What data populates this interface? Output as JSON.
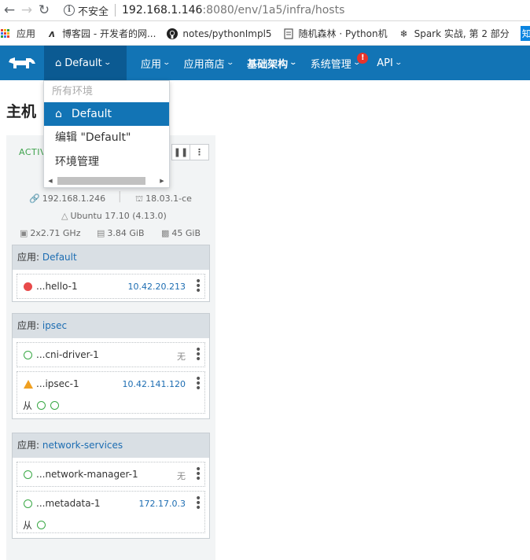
{
  "browser": {
    "insecure_label": "不安全",
    "url_host": "192.168.1.146",
    "url_path": ":8080/env/1a5/infra/hosts"
  },
  "bookmarks": [
    {
      "label": "应用",
      "icon": "apps-grid-icon"
    },
    {
      "label": "博客园 - 开发者的网...",
      "icon": "cnblogs-icon"
    },
    {
      "label": "notes/pythonImpl5",
      "icon": "github-icon"
    },
    {
      "label": "随机森林 · Python机",
      "icon": "page-icon"
    },
    {
      "label": "Spark 实战, 第 2 部分",
      "icon": "spark-icon"
    },
    {
      "label": "知",
      "icon": "zhihu-icon"
    }
  ],
  "header": {
    "env_label": "Default",
    "nav": [
      {
        "label": "应用",
        "bold": false
      },
      {
        "label": "应用商店",
        "bold": false
      },
      {
        "label": "基础架构",
        "bold": true
      },
      {
        "label": "系统管理",
        "bold": false,
        "badge": "!"
      },
      {
        "label": "API",
        "bold": false
      }
    ]
  },
  "dropdown": {
    "header": "所有环境",
    "selected": "Default",
    "items": [
      "编辑 \"Default\"",
      "环境管理"
    ]
  },
  "page": {
    "title": "主机"
  },
  "host": {
    "state": "ACTIVE",
    "ip": "192.168.1.246",
    "docker_version": "18.03.1-ce",
    "os": "Ubuntu 17.10 (4.13.0)",
    "cpu": "2x2.71 GHz",
    "memory": "3.84 GiB",
    "disk": "45 GiB"
  },
  "stacks": [
    {
      "prefix": "应用: ",
      "name": "Default",
      "containers": [
        {
          "name": "...hello-1",
          "ip": "10.42.20.213",
          "status": "stopped"
        }
      ]
    },
    {
      "prefix": "应用: ",
      "name": "ipsec",
      "containers": [
        {
          "name": "...cni-driver-1",
          "ip": "无",
          "status": "running"
        },
        {
          "name": "...ipsec-1",
          "ip": "10.42.141.120",
          "status": "warning",
          "from_label": "从"
        }
      ]
    },
    {
      "prefix": "应用: ",
      "name": "network-services",
      "containers": [
        {
          "name": "...network-manager-1",
          "ip": "无",
          "status": "running"
        },
        {
          "name": "...metadata-1",
          "ip": "172.17.0.3",
          "status": "running",
          "from_label": "从"
        }
      ]
    }
  ],
  "colors": {
    "header_bg": "#1274b5",
    "env_tab_bg": "#0b5a92",
    "active_green": "#3fa34d",
    "link_blue": "#1d6db2",
    "error_red": "#e84a4a",
    "warn_orange": "#f0a020"
  }
}
